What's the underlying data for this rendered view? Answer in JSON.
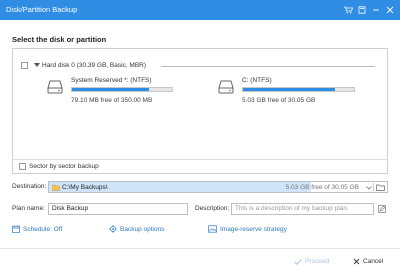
{
  "window": {
    "title": "Disk/Partition Backup",
    "controls": [
      "cart-icon",
      "help-icon",
      "minimize-icon",
      "close-icon"
    ]
  },
  "select_section": {
    "title": "Select the disk or partition"
  },
  "disk": {
    "label": "Hard disk 0 (30.39 GB, Basic, MBR)",
    "partitions": [
      {
        "name": "System Reserved *: (NTFS)",
        "free_text": "79.10 MB free of 350.00 MB",
        "used_fraction": 0.77
      },
      {
        "name": "C: (NTFS)",
        "free_text": "5.03 GB free of 30.05 GB",
        "used_fraction": 0.83
      }
    ]
  },
  "sector_backup": {
    "label": "Sector by sector backup",
    "checked": false
  },
  "destination": {
    "label": "Destination:",
    "path": "C:\\My Backups\\",
    "space_text": "5.03 GB free of 30.05 GB"
  },
  "plan": {
    "label": "Plan name:",
    "value": "Disk Backup"
  },
  "description": {
    "label": "Description:",
    "placeholder": "This is a description of my backup plan."
  },
  "options": {
    "schedule": "Schedule: Off",
    "backup_options": "Backup options",
    "image_reserve": "Image-reserve strategy"
  },
  "footer": {
    "proceed": "Proceed",
    "cancel": "Cancel"
  },
  "colors": {
    "accent": "#2f8de4",
    "link": "#2f79c6",
    "disabled": "#a9c3de"
  }
}
